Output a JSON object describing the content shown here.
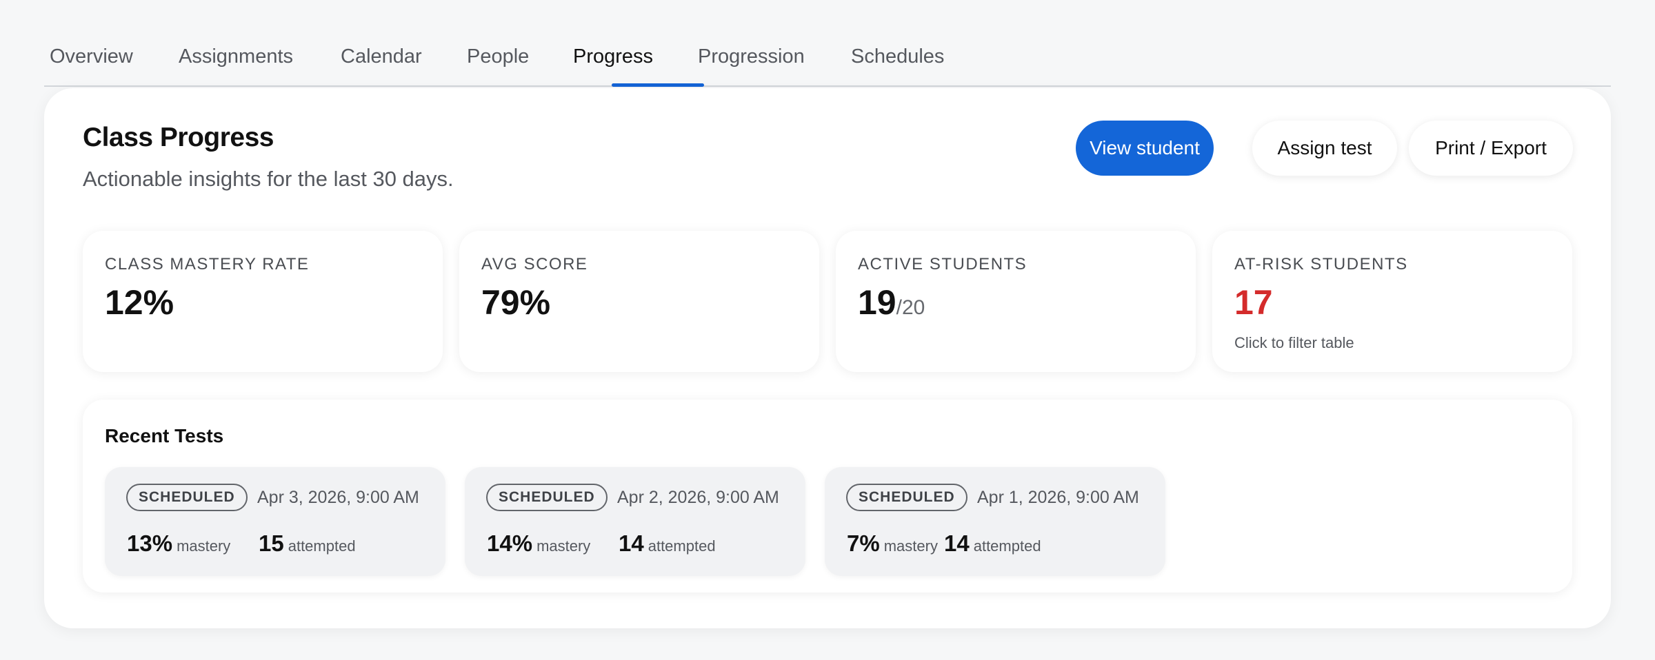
{
  "tabs": {
    "overview": "Overview",
    "assignments": "Assignments",
    "calendar": "Calendar",
    "people": "People",
    "progress": "Progress",
    "progression": "Progression",
    "schedules": "Schedules",
    "active": "Progress"
  },
  "header": {
    "title": "Class Progress",
    "subtitle": "Actionable insights for the last 30 days."
  },
  "actions": {
    "view_student": "View student",
    "assign_test": "Assign test",
    "print_export": "Print / Export"
  },
  "stats": {
    "mastery": {
      "label": "CLASS MASTERY RATE",
      "value": "12%"
    },
    "avg_score": {
      "label": "AVG SCORE",
      "value": "79%"
    },
    "active": {
      "label": "ACTIVE STUDENTS",
      "value": "19",
      "total": "/20"
    },
    "at_risk": {
      "label": "AT-RISK STUDENTS",
      "value": "17",
      "hint": "Click to filter table"
    }
  },
  "recent_tests": {
    "title": "Recent Tests",
    "mastery_label": "mastery",
    "attempted_label": "attempted",
    "items": [
      {
        "status": "SCHEDULED",
        "date": "Apr 3, 2026, 9:00 AM",
        "mastery": "13%",
        "attempted": "15"
      },
      {
        "status": "SCHEDULED",
        "date": "Apr 2, 2026, 9:00 AM",
        "mastery": "14%",
        "attempted": "14"
      },
      {
        "status": "SCHEDULED",
        "date": "Apr 1, 2026, 9:00 AM",
        "mastery": "7%",
        "attempted": "14"
      }
    ]
  },
  "colors": {
    "accent": "#1466d8",
    "risk": "#d42b2b"
  }
}
